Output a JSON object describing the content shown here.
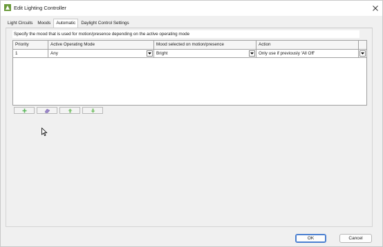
{
  "window": {
    "title": "Edit Lighting Controller"
  },
  "tabs": [
    {
      "label": "Light Circuits",
      "active": false
    },
    {
      "label": "Moods",
      "active": false
    },
    {
      "label": "Automatic",
      "active": true
    },
    {
      "label": "Daylight Control Settings",
      "active": false
    }
  ],
  "panel": {
    "description": "Specify the mood that is used for motion/presence depending on the active operating mode"
  },
  "table": {
    "columns": [
      "Priority",
      "Active Operating Mode",
      "Mood selected on motion/presence",
      "Action"
    ],
    "rows": [
      {
        "priority": "1",
        "mode": "Any",
        "mood": "Bright",
        "action": "Only use if previously 'All Off'"
      }
    ]
  },
  "toolbar": {
    "buttons": [
      {
        "name": "add",
        "icon": "plus-icon"
      },
      {
        "name": "remove",
        "icon": "eraser-icon"
      },
      {
        "name": "move-up",
        "icon": "arrow-up-icon"
      },
      {
        "name": "move-down",
        "icon": "arrow-down-icon"
      }
    ]
  },
  "footer": {
    "ok_label": "OK",
    "cancel_label": "Cancel"
  },
  "colors": {
    "accent": "#4a7fd0",
    "toolbar_icon_green": "#5cb85c",
    "app_icon_green": "#6a9a3a"
  }
}
